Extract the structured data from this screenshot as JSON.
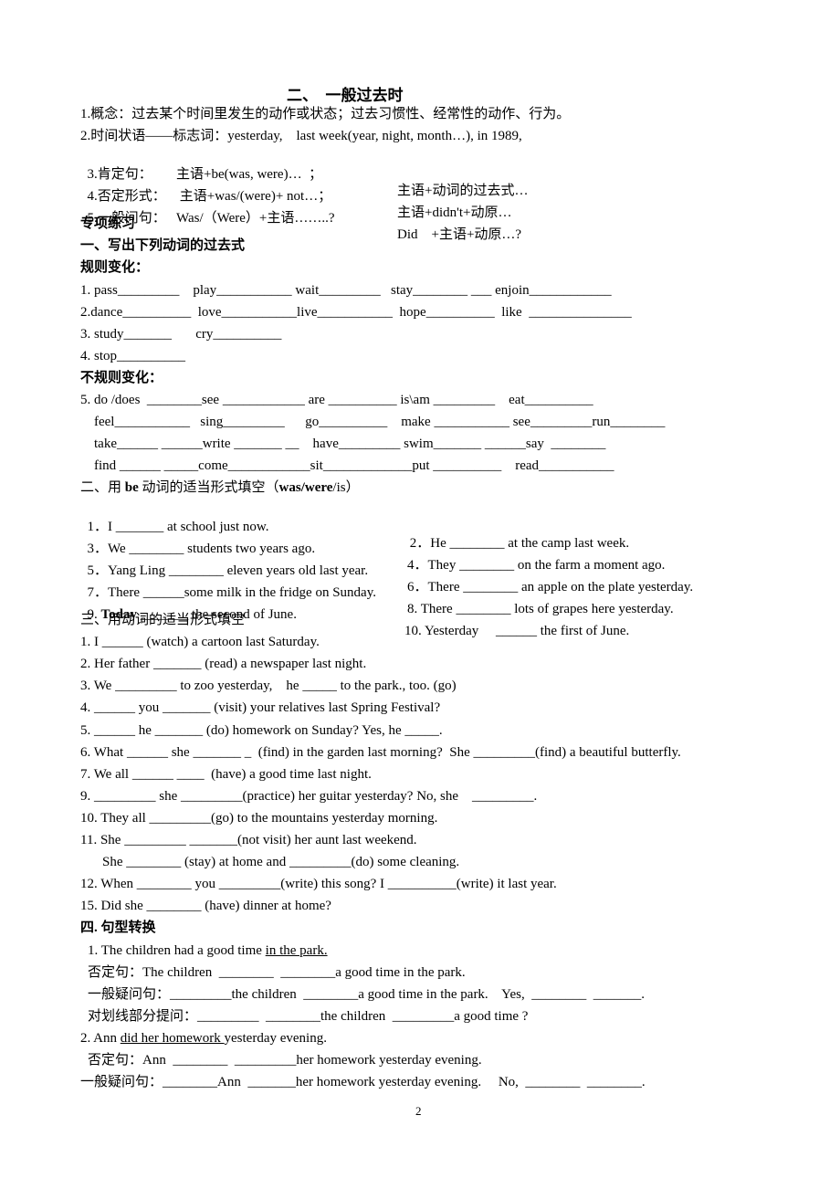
{
  "title": "二、  一般过去时",
  "intro": {
    "l1": "1.概念：过去某个时间里发生的动作或状态；过去习惯性、经常性的动作、行为。",
    "l2": "2.时间状语——标志词：yesterday,    last week(year, night, month…), in 1989,",
    "l3a": "3.肯定句：       主语+be(was, were)…  ；",
    "l3b": "主语+动词的过去式…",
    "l4a": "4.否定形式：    主语+was/(were)+ not…；",
    "l4b": "主语+didn't+动原…",
    "l5a": "5.一般问句：   Was/（Were）+主语……..?",
    "l5b": "Did    +主语+动原…?"
  },
  "practice_heading": "专项练习",
  "s1": {
    "heading": "一、写出下列动词的过去式",
    "regular_label": "规则变化：",
    "regular": [
      "1. pass_________    play___________ wait_________   stay________ ___ enjoin____________",
      "2.dance__________  love___________live___________  hope__________  like  _______________",
      "3. study_______       cry__________",
      "4. stop__________"
    ],
    "irregular_label": "不规则变化：",
    "irregular": [
      "5. do /does  ________see ____________ are __________ is\\am _________    eat__________",
      "feel___________   sing_________      go__________    make ___________ see_________run________",
      "take______ ______write _______ __    have_________ swim_______ ______say  ________",
      "find ______ _____come____________sit_____________put __________    read___________"
    ]
  },
  "s2": {
    "heading_pre": "二、用 ",
    "heading_bold1": "be",
    "heading_mid": " 动词的适当形式填空（",
    "heading_bold2": "was/were",
    "heading_post": "/is）",
    "items": [
      {
        "left": "1．I _______ at school just now.",
        "right": " 2．He ________ at the camp last week."
      },
      {
        "left": "3．We ________ students two years ago.",
        "right": "4．They ________ on the farm a moment ago."
      },
      {
        "left": "5．Yang Ling ________ eleven years old last year.",
        "right": "6．There ________ an apple on the plate yesterday."
      },
      {
        "left": "7．There ______some milk in the fridge on Sunday.",
        "right": "8. There ________ lots of grapes here yesterday."
      }
    ],
    "item9_pre": "9. ",
    "item9_bold": "Today",
    "item9_post": " _______ the second of June.",
    "item10": "10. Yesterday     ______ the first of June."
  },
  "s3": {
    "heading": "三、用动词的适当形式填空",
    "items": [
      "1. I ______ (watch) a cartoon last Saturday.",
      "2. Her father _______ (read) a newspaper last night.",
      "3. We _________ to zoo yesterday,    he _____ to the park., too. (go)",
      "4. ______ you _______ (visit) your relatives last Spring Festival?",
      "5. ______ he _______ (do) homework on Sunday? Yes, he _____.",
      "6. What ______ she _______ _  (find) in the garden last morning?  She _________(find) a beautiful butterfly.",
      "7. We all ______ ____  (have) a good time last night.",
      "9. _________ she _________(practice) her guitar yesterday? No, she    _________.",
      "10. They all _________(go) to the mountains yesterday morning.",
      "11. She _________ _______(not visit) her aunt last weekend.",
      "She ________ (stay) at home and _________(do) some cleaning.",
      "12. When ________ you _________(write) this song? I __________(write) it last year.",
      "15. Did she ________ (have) dinner at home?"
    ]
  },
  "s4": {
    "heading": "四. 句型转换",
    "q1_pre": "1. The children had a good time ",
    "q1_under": "in the park.",
    "q1_neg": "否定句：The children  ________  ________a good time in the park.",
    "q1_yn": "一般疑问句：_________the children  ________a good time in the park.    Yes,  ________  _______.",
    "q1_wh": "对划线部分提问：_________  ________the children  _________a good time ?",
    "q2_pre": "2. Ann ",
    "q2_under": "did her homework ",
    "q2_post": "yesterday evening.",
    "q2_neg": "否定句：Ann  ________  _________her homework yesterday evening.",
    "q2_yn": "一般疑问句：________Ann  _______her homework yesterday evening.     No,  ________  ________."
  },
  "page_number": "2"
}
